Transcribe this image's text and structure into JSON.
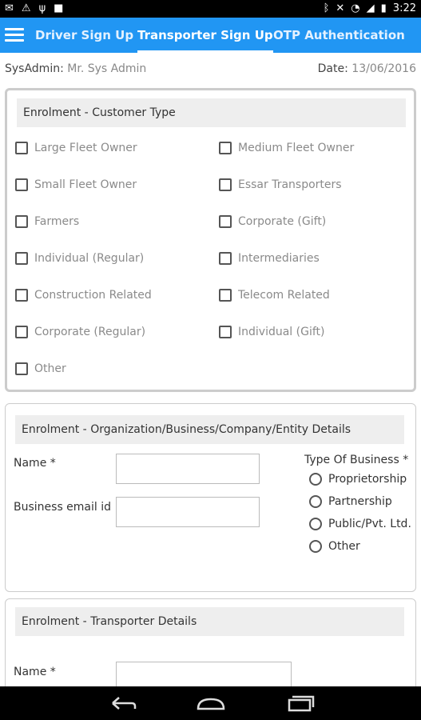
{
  "status": {
    "time": "3:22"
  },
  "tabs": [
    "Driver Sign Up",
    "Transporter Sign Up",
    "OTP Authentication"
  ],
  "sysadmin": {
    "label": "SysAdmin:",
    "value": "Mr. Sys Admin"
  },
  "date": {
    "label": "Date:",
    "value": "13/06/2016"
  },
  "customer_type": {
    "title": "Enrolment - Customer Type",
    "left": [
      "Large Fleet Owner",
      "Small Fleet Owner",
      "Farmers",
      "Individual (Regular)",
      "Construction Related",
      "Corporate (Regular)",
      "Other"
    ],
    "right": [
      "Medium Fleet Owner",
      "Essar Transporters",
      "Corporate (Gift)",
      "Intermediaries",
      "Telecom Related",
      "Individual (Gift)"
    ]
  },
  "org": {
    "title": "Enrolment - Organization/Business/Company/Entity Details",
    "name_label": "Name *",
    "email_label": "Business email id",
    "business_type_label": "Type Of Business *",
    "business_types": [
      "Proprietorship",
      "Partnership",
      "Public/Pvt. Ltd.",
      "Other"
    ]
  },
  "transporter": {
    "title": "Enrolment - Transporter Details",
    "name_label": "Name *"
  }
}
